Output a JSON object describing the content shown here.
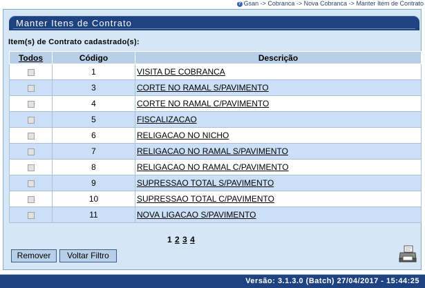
{
  "breadcrumb": {
    "text": "Gsan -> Cobranca -> Nova Cobranca -> Manter Item de Contrato"
  },
  "panel": {
    "title": "Manter Itens de Contrato",
    "section_label": "Item(s) de Contrato cadastrado(s):"
  },
  "table": {
    "headers": {
      "todos": "Todos",
      "codigo": "Código",
      "descricao": "Descrição"
    },
    "rows": [
      {
        "code": "1",
        "desc": "VISITA DE COBRANCA"
      },
      {
        "code": "3",
        "desc": "CORTE NO RAMAL S/PAVIMENTO"
      },
      {
        "code": "4",
        "desc": "CORTE NO RAMAL C/PAVIMENTO"
      },
      {
        "code": "5",
        "desc": "FISCALIZACAO"
      },
      {
        "code": "6",
        "desc": "RELIGACAO NO NICHO"
      },
      {
        "code": "7",
        "desc": "RELIGACAO NO RAMAL S/PAVIMENTO"
      },
      {
        "code": "8",
        "desc": "RELIGACAO NO RAMAL C/PAVIMENTO"
      },
      {
        "code": "9",
        "desc": "SUPRESSAO TOTAL S/PAVIMENTO"
      },
      {
        "code": "10",
        "desc": "SUPRESSAO TOTAL C/PAVIMENTO"
      },
      {
        "code": "11",
        "desc": "NOVA LIGACAO S/PAVIMENTO"
      }
    ]
  },
  "pager": {
    "current": "1",
    "pages": [
      "2",
      "3",
      "4"
    ]
  },
  "buttons": {
    "remove": "Remover",
    "back": "Voltar Filtro"
  },
  "icons": {
    "help": "help-icon",
    "print": "printer-icon"
  },
  "footer": {
    "version": "Versão: 3.1.3.0 (Batch) 27/04/2017 - 15:44:25"
  },
  "colors": {
    "header_dark": "#1f4280",
    "panel_bg": "#d5e6f6",
    "row_alt": "#cbe0f6",
    "table_header": "#b8cfe8"
  }
}
